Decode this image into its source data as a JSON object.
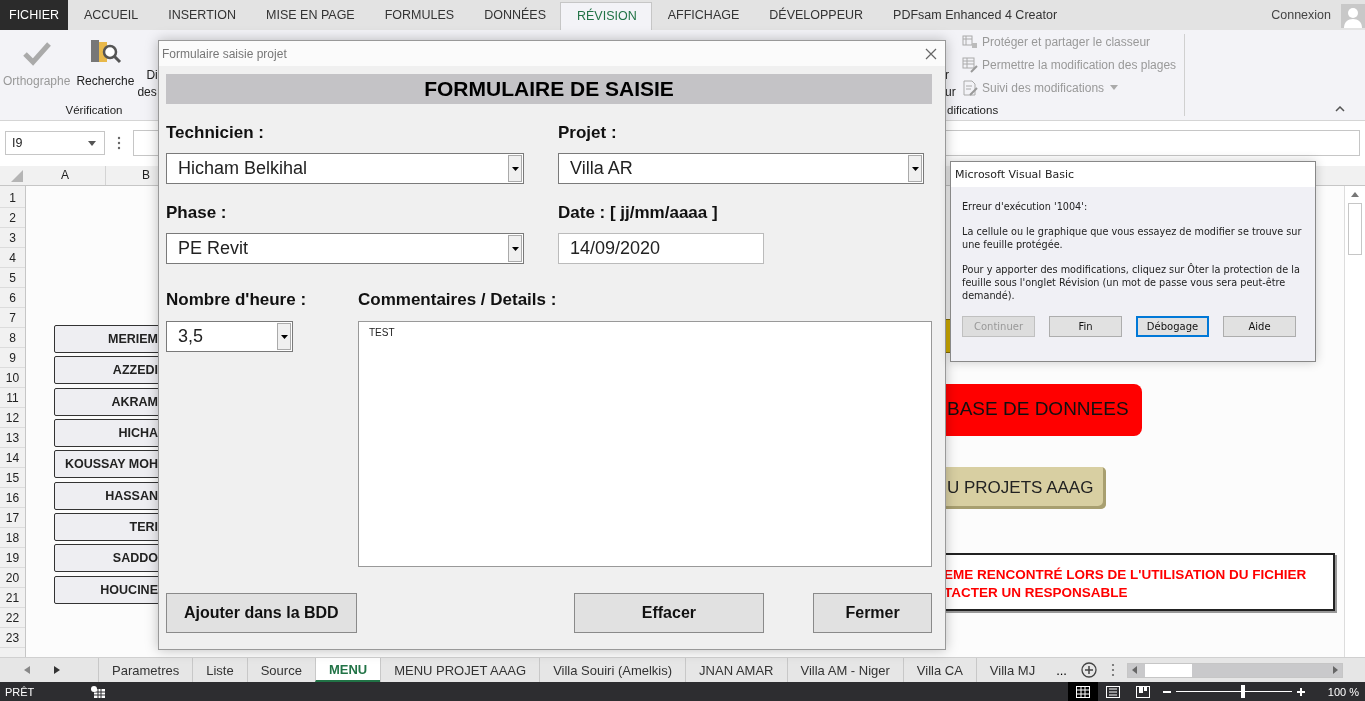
{
  "ribbon_tabs": [
    {
      "label": "FICHIER",
      "kind": "file",
      "selected": false
    },
    {
      "label": "ACCUEIL",
      "kind": "tab",
      "selected": false
    },
    {
      "label": "INSERTION",
      "kind": "tab",
      "selected": false
    },
    {
      "label": "MISE EN PAGE",
      "kind": "tab",
      "selected": false
    },
    {
      "label": "FORMULES",
      "kind": "tab",
      "selected": false
    },
    {
      "label": "DONNÉES",
      "kind": "tab",
      "selected": false
    },
    {
      "label": "RÉVISION",
      "kind": "tab",
      "selected": true
    },
    {
      "label": "AFFICHAGE",
      "kind": "tab",
      "selected": false
    },
    {
      "label": "DÉVELOPPEUR",
      "kind": "tab",
      "selected": false
    },
    {
      "label": "PDFsam Enhanced 4 Creator",
      "kind": "tab",
      "selected": false
    }
  ],
  "account": {
    "label": "Connexion"
  },
  "ribbon": {
    "left_buttons": [
      {
        "label": "Orthographe",
        "kind": "spelling",
        "disabled": true
      },
      {
        "label": "Recherche",
        "kind": "research",
        "disabled": false
      }
    ],
    "cut_labels": [
      "Di",
      "des"
    ],
    "left_group": "Vérification",
    "right_cut_labels": [
      "r",
      "ur"
    ],
    "right_items": [
      {
        "label": "Protéger et partager le classeur",
        "kind": "share",
        "dropdown": false
      },
      {
        "label": "Permettre la modification des plages",
        "kind": "ranges",
        "dropdown": false
      },
      {
        "label": "Suivi des modifications",
        "kind": "track",
        "dropdown": true
      }
    ],
    "right_group": "difications"
  },
  "name_box": "I9",
  "columns": [
    "A",
    "B"
  ],
  "rows": [
    "1",
    "2",
    "3",
    "4",
    "5",
    "6",
    "7",
    "8",
    "9",
    "10",
    "11",
    "12",
    "13",
    "14",
    "15",
    "16",
    "17",
    "18",
    "19",
    "20",
    "21",
    "22",
    "23"
  ],
  "sheet_buttons": [
    "MERIEM",
    "AZZEDI",
    "AKRAM",
    "HICHA",
    "KOUSSAY MOH",
    "HASSAN",
    "TERI",
    "SADDO",
    "HOUCINE"
  ],
  "shapes": [
    {
      "kind": "gold"
    },
    {
      "kind": "red",
      "lines": [
        "BASE DE DONNEES"
      ]
    },
    {
      "kind": "khaki",
      "lines": [
        "U PROJETS AAAG"
      ]
    },
    {
      "kind": "notice",
      "lines": [
        "EME RENCONTRÉ LORS DE L'UTILISATION DU FICHIER",
        "TACTER UN RESPONSABLE"
      ]
    }
  ],
  "sheet_tabs": [
    {
      "label": "Parametres",
      "selected": false
    },
    {
      "label": "Liste",
      "selected": false
    },
    {
      "label": "Source",
      "selected": false
    },
    {
      "label": "MENU",
      "selected": true
    },
    {
      "label": "MENU PROJET AAAG",
      "selected": false
    },
    {
      "label": "Villa Souiri (Amelkis)",
      "selected": false
    },
    {
      "label": "JNAN AMAR",
      "selected": false
    },
    {
      "label": "Villa AM - Niger",
      "selected": false
    },
    {
      "label": "Villa CA",
      "selected": false
    },
    {
      "label": "Villa MJ",
      "selected": false
    }
  ],
  "more_tabs": "...",
  "status": {
    "text": "PRÊT",
    "zoom": {
      "level": 0.58,
      "reading": "100 %"
    }
  },
  "form": {
    "title": "Formulaire saisie projet",
    "heading": "FORMULAIRE DE SAISIE",
    "fields": [
      {
        "label": "Technicien :",
        "value": "Hicham Belkihal",
        "kind": "combo"
      },
      {
        "label": "Projet :",
        "value": "Villa AR",
        "kind": "combo"
      },
      {
        "label": "Phase :",
        "value": "PE Revit",
        "kind": "combo"
      },
      {
        "label": "Date : [ jj/mm/aaaa ]",
        "value": "14/09/2020",
        "kind": "text"
      }
    ],
    "hours": {
      "label": "Nombre d'heure :",
      "value": "3,5"
    },
    "comments": {
      "label": "Commentaires / Details :",
      "value": "TEST"
    },
    "buttons": [
      "Ajouter dans la BDD",
      "Effacer",
      "Fermer"
    ]
  },
  "error_dialog": {
    "title": "Microsoft Visual Basic",
    "heading": "Erreur d'exécution '1004':",
    "paragraphs": [
      "La cellule ou le graphique que vous essayez de modifier se trouve sur une feuille protégée.",
      "Pour y apporter des modifications, cliquez sur Ôter la protection de la feuille sous l'onglet Révision (un mot de passe vous sera peut-être demandé)."
    ],
    "buttons": [
      {
        "label": "Continuer",
        "disabled": true,
        "focused": false
      },
      {
        "label": "Fin",
        "disabled": false,
        "focused": false
      },
      {
        "label": "Débogage",
        "disabled": false,
        "focused": true
      },
      {
        "label": "Aide",
        "disabled": false,
        "focused": false
      }
    ]
  }
}
